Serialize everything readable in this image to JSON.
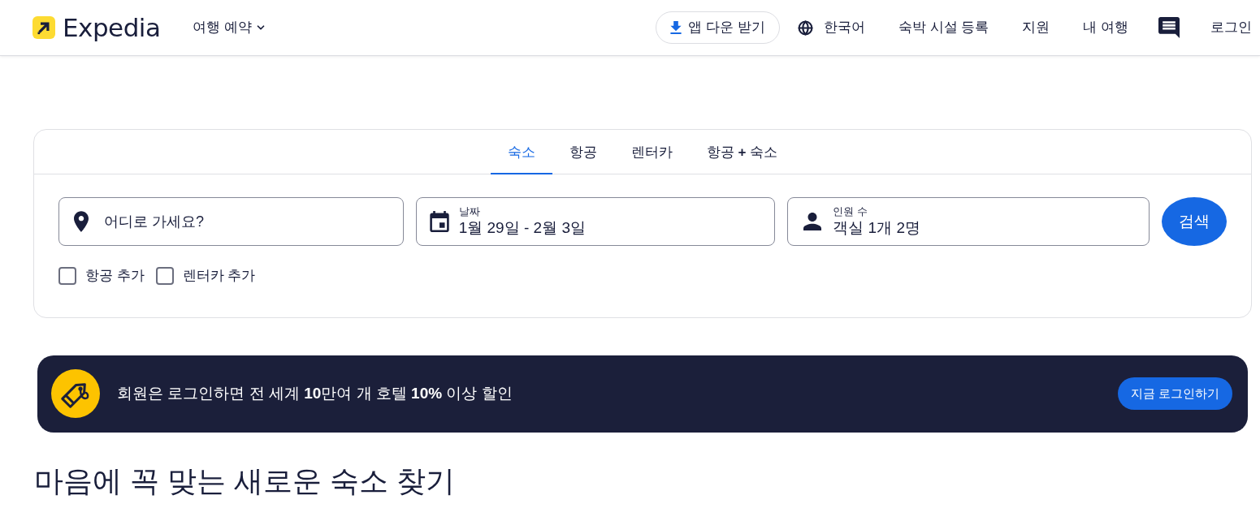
{
  "header": {
    "brand": "Expedia",
    "menu": {
      "label": "여행 예약"
    },
    "app_button": "앱 다운 받기",
    "language": "한국어",
    "links": [
      "숙박 시설 등록",
      "지원",
      "내 여행"
    ],
    "login": "로그인"
  },
  "search": {
    "tabs": [
      {
        "label": "숙소",
        "selected": true
      },
      {
        "label": "항공",
        "selected": false
      },
      {
        "label": "렌터카",
        "selected": false
      },
      {
        "label": "항공 **+** 숙소",
        "selected": false
      }
    ],
    "destination": {
      "placeholder": "어디로 가세요?"
    },
    "dates": {
      "label": "날짜",
      "value": "1월 29일 - 2월 3일"
    },
    "travelers": {
      "label": "인원 수",
      "value": "객실 1개 2명"
    },
    "search_button": "검색",
    "add_ons": [
      {
        "label": "항공 추가",
        "checked": false
      },
      {
        "label": "렌터카 추가",
        "checked": false
      }
    ]
  },
  "banner": {
    "text": "회원은 로그인하면 전 세계 **10**만여 개 호텔 **10%** 이상 할인",
    "button": "지금 로그인하기"
  },
  "heading": "마음에 꼭 맞는 새로운 숙소 찾기"
}
